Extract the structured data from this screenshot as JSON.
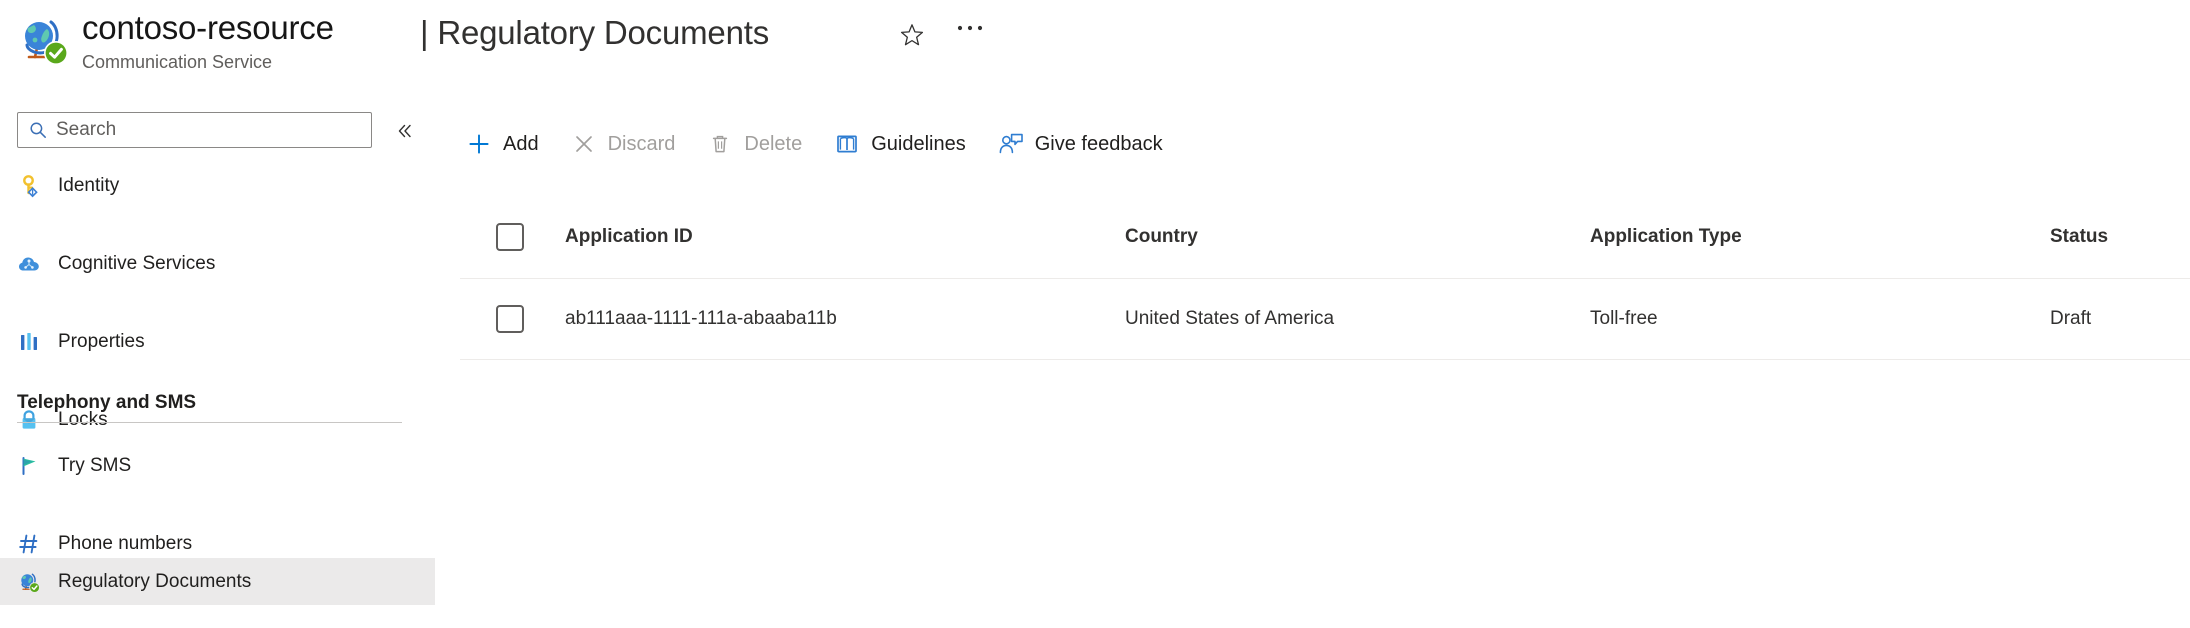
{
  "header": {
    "resource_name": "contoso-resource",
    "resource_type": "Communication Service",
    "page_title": "| Regulatory Documents",
    "resource_icon": "globe-check-icon",
    "favorite_icon": "star-outline-icon",
    "more_icon": "ellipsis-icon"
  },
  "sidebar": {
    "search": {
      "placeholder": "Search",
      "value": "",
      "icon": "search-icon"
    },
    "collapse_icon": "double-chevron-left-icon",
    "items": [
      {
        "label": "Identity",
        "icon": "key-icon",
        "selected": false
      },
      {
        "label": "Cognitive Services",
        "icon": "cloud-icon",
        "selected": false
      },
      {
        "label": "Properties",
        "icon": "bars-icon",
        "selected": false
      },
      {
        "label": "Locks",
        "icon": "lock-icon",
        "selected": false
      }
    ],
    "section": {
      "title": "Telephony and SMS",
      "items": [
        {
          "label": "Try SMS",
          "icon": "flag-icon",
          "selected": false
        },
        {
          "label": "Phone numbers",
          "icon": "hash-icon",
          "selected": false
        },
        {
          "label": "Regulatory Documents",
          "icon": "globe-check-icon",
          "selected": true
        }
      ]
    }
  },
  "toolbar": {
    "items": [
      {
        "label": "Add",
        "icon": "plus-icon",
        "disabled": false
      },
      {
        "label": "Discard",
        "icon": "cross-icon",
        "disabled": true
      },
      {
        "label": "Delete",
        "icon": "trash-icon",
        "disabled": true
      },
      {
        "label": "Guidelines",
        "icon": "book-icon",
        "disabled": false
      },
      {
        "label": "Give feedback",
        "icon": "person-feedback-icon",
        "disabled": false
      }
    ]
  },
  "table": {
    "columns": {
      "application_id": "Application ID",
      "country": "Country",
      "application_type": "Application Type",
      "status": "Status"
    },
    "rows": [
      {
        "application_id": "ab111aaa-1111-111a-abaaba11b",
        "country": "United States of America",
        "application_type": "Toll-free",
        "status": "Draft",
        "selected": false
      }
    ]
  },
  "colors": {
    "accent_blue": "#0078d4",
    "icon_blue": "#3b7fd4",
    "disabled_grey": "#a19f9d",
    "selected_bg": "#ebeaea",
    "border_grey": "#edebe9",
    "badge_green": "#57a300"
  }
}
